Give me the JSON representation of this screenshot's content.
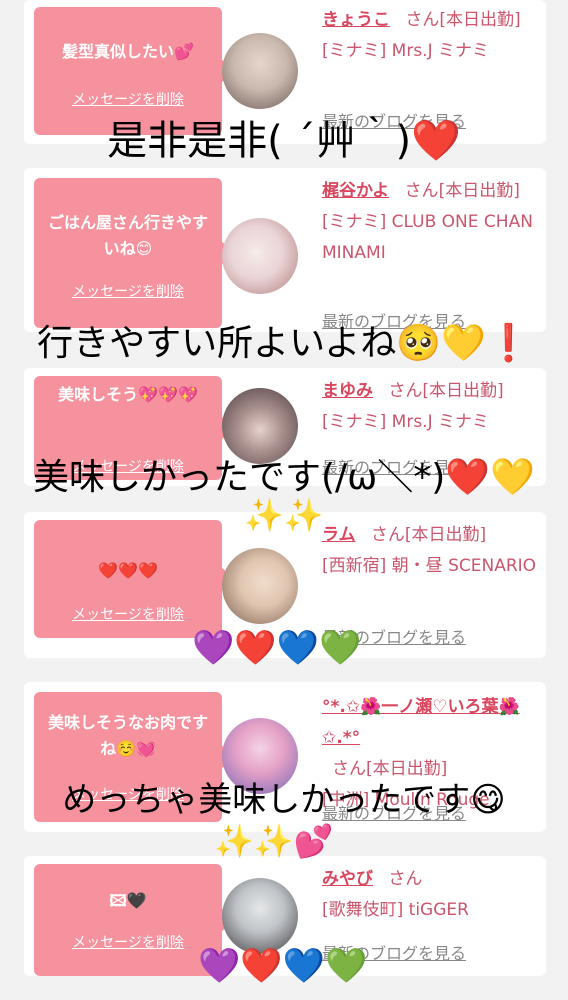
{
  "delete_label": "メッセージを削除",
  "blog_label": "最新のブログを見る",
  "san_suffix": "さん",
  "cards": [
    {
      "message": "髪型真似したい💕",
      "name": "きょうこ",
      "status": "[本日出勤]",
      "shop": "[ミナミ] Mrs.J ミナミ",
      "avatar_colors": [
        "#c9b8ad",
        "#6b5a55"
      ]
    },
    {
      "message": "ごはん屋さん行きやすいね😊",
      "name": "梶谷かよ",
      "status": "[本日出勤]",
      "shop": "[ミナミ] CLUB ONE CHAN MINAMI",
      "avatar_colors": [
        "#e9d3d6",
        "#b07b78"
      ]
    },
    {
      "message": "美味しそう💖💖💖",
      "name": "まゆみ",
      "status": "[本日出勤]",
      "shop": "[ミナミ] Mrs.J ミナミ",
      "avatar_colors": [
        "#4a3c3f",
        "#d8c2bf"
      ]
    },
    {
      "message": "❤️❤️❤️",
      "name": "ラム",
      "status": "[本日出勤]",
      "shop": "[西新宿] 朝・昼 SCENARIO",
      "avatar_colors": [
        "#7a5e4d",
        "#e0c6b1"
      ]
    },
    {
      "message": "美味しそうなお肉ですね☺️💓",
      "name": "°*.✩🌺一ノ瀬♡いろ葉🌺✩.*°",
      "status": "[本日出勤]",
      "shop": "[中洲] Moulin Rouge",
      "avatar_colors": [
        "#7466b6",
        "#e6a1c6"
      ]
    },
    {
      "message": "🖾🖤",
      "name": "みやび",
      "status": "",
      "shop": "[歌舞伎町] tiGGER",
      "avatar_colors": [
        "#bfc3c7",
        "#3c3a3d"
      ]
    }
  ],
  "overlays": {
    "line1": "是非是非( ´艸｀)❤️",
    "line2": "行きやすい所よいよね🥺💛❗",
    "line3": "美味しかったです(/ω＼*)❤️💛",
    "sparkles1": "✨✨",
    "hearts1": "💜❤️💙💚",
    "line4": "めっちゃ美味しかったです😋",
    "sparkles2": "✨✨💕",
    "hearts2": "💜❤️💙💚"
  }
}
